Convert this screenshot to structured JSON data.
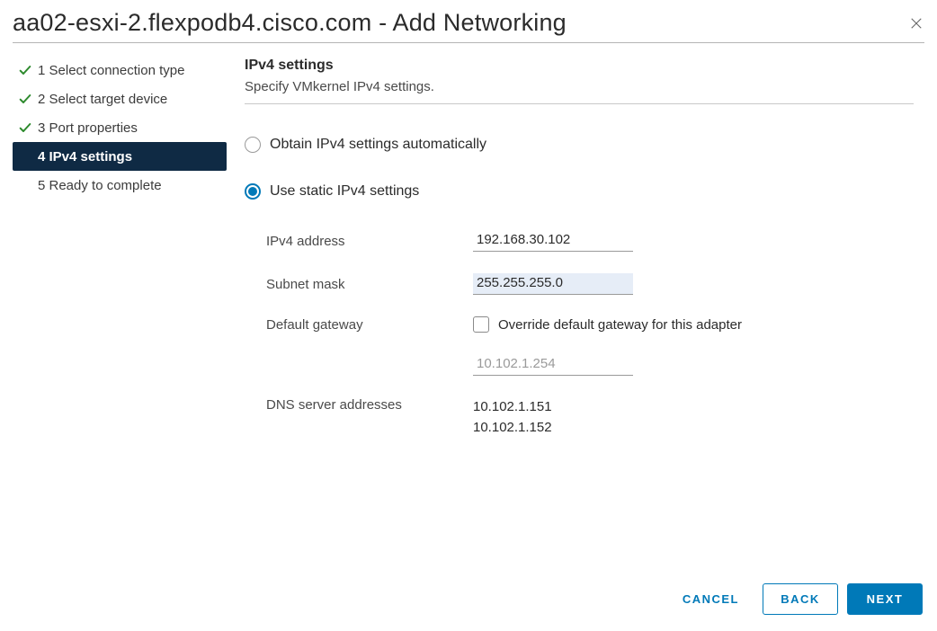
{
  "dialog": {
    "title": "aa02-esxi-2.flexpodb4.cisco.com - Add Networking"
  },
  "sidebar": {
    "steps": [
      {
        "label": "1 Select connection type",
        "completed": true,
        "active": false
      },
      {
        "label": "2 Select target device",
        "completed": true,
        "active": false
      },
      {
        "label": "3 Port properties",
        "completed": true,
        "active": false
      },
      {
        "label": "4 IPv4 settings",
        "completed": false,
        "active": true
      },
      {
        "label": "5 Ready to complete",
        "completed": false,
        "active": false
      }
    ]
  },
  "section": {
    "title": "IPv4 settings",
    "subtitle": "Specify VMkernel IPv4 settings."
  },
  "radios": {
    "auto": {
      "label": "Obtain IPv4 settings automatically",
      "selected": false
    },
    "static": {
      "label": "Use static IPv4 settings",
      "selected": true
    }
  },
  "form": {
    "ipv4_address": {
      "label": "IPv4 address",
      "value": "192.168.30.102"
    },
    "subnet_mask": {
      "label": "Subnet mask",
      "value": "255.255.255.0"
    },
    "default_gateway": {
      "label": "Default gateway",
      "override_label": "Override default gateway for this adapter",
      "override_checked": false,
      "value": "10.102.1.254"
    },
    "dns": {
      "label": "DNS server addresses",
      "line1": "10.102.1.151",
      "line2": "10.102.1.152"
    }
  },
  "footer": {
    "cancel": "CANCEL",
    "back": "BACK",
    "next": "NEXT"
  }
}
